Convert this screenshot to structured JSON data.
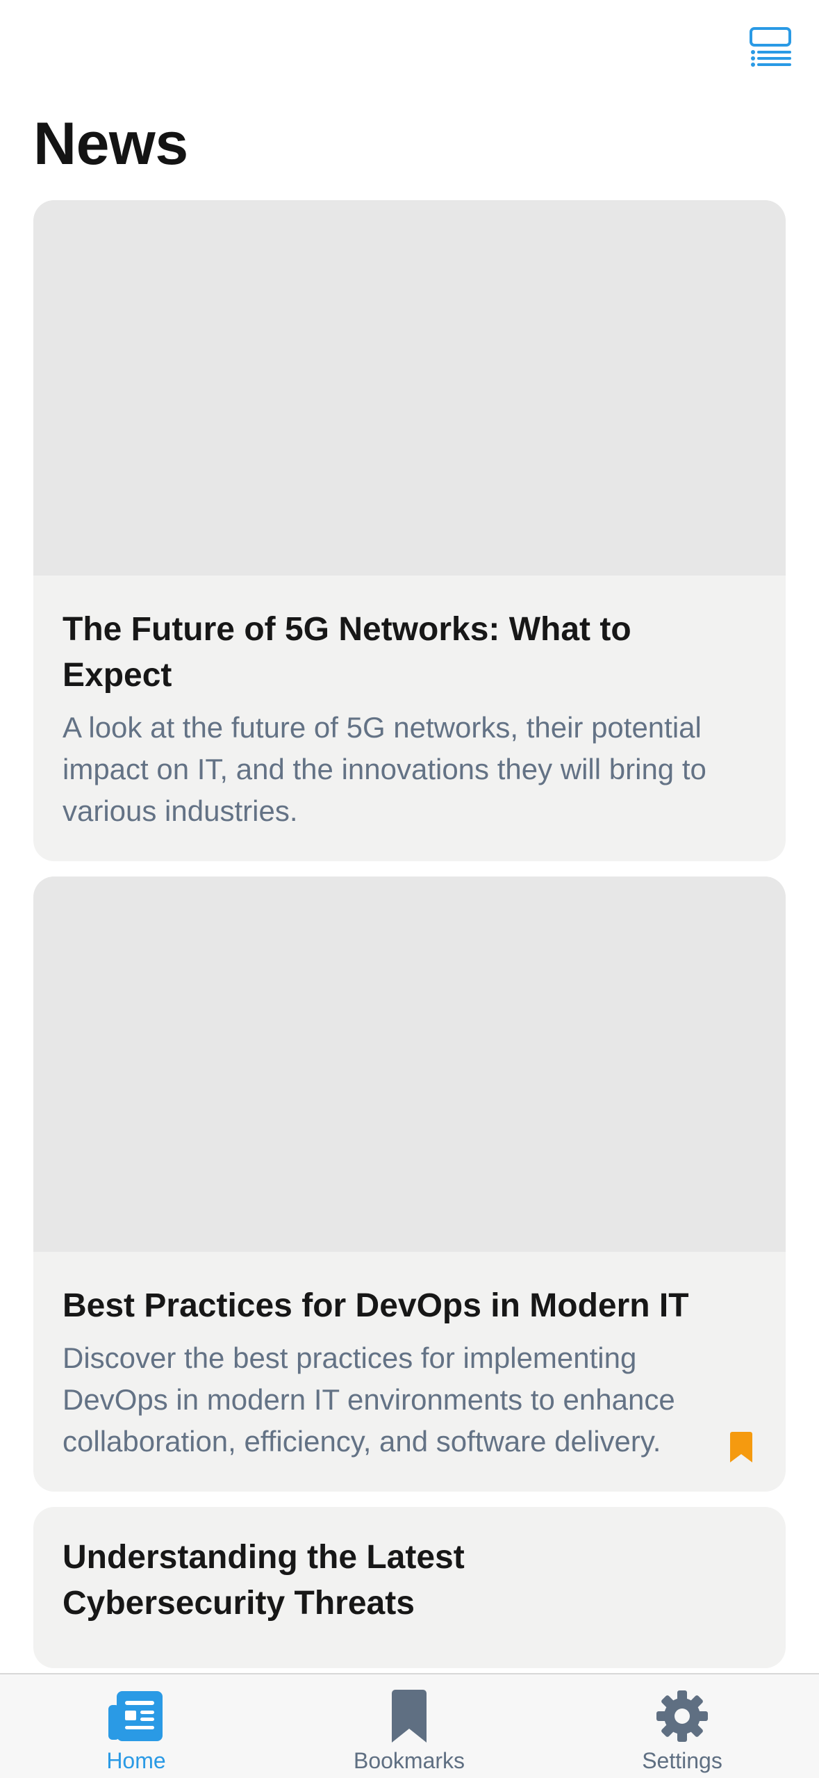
{
  "header": {
    "title": "News",
    "action_icon": "list-view-icon"
  },
  "colors": {
    "accent": "#2a9ae5",
    "bookmark": "#f59a0f",
    "inactive": "#5f6f82"
  },
  "articles": [
    {
      "title": "The Future of 5G Networks: What to Expect",
      "summary": "A look at the future of 5G networks, their potential impact on IT, and the innovations they will bring to various industries.",
      "bookmarked": false
    },
    {
      "title": "Best Practices for DevOps in Modern IT",
      "summary": "Discover the best practices for implementing DevOps in modern IT environments to enhance collaboration, efficiency, and software delivery.",
      "bookmarked": true
    },
    {
      "title": "Understanding the Latest Cybersecurity Threats"
    }
  ],
  "tab_bar": {
    "tabs": [
      {
        "label": "Home",
        "icon": "newspaper-icon",
        "active": true
      },
      {
        "label": "Bookmarks",
        "icon": "bookmark-icon",
        "active": false
      },
      {
        "label": "Settings",
        "icon": "gear-icon",
        "active": false
      }
    ]
  }
}
